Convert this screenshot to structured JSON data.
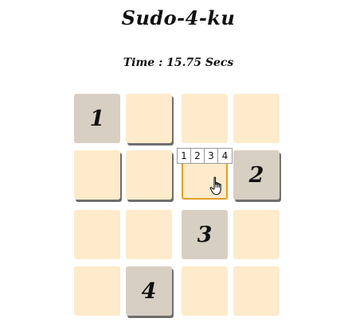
{
  "game": {
    "title": "Sudo-4-ku",
    "timer_text": "Time : 15.75 Secs"
  },
  "board": {
    "rows": [
      [
        "1",
        "",
        "",
        ""
      ],
      [
        "",
        "",
        "",
        "2"
      ],
      [
        "",
        "",
        "3",
        ""
      ],
      [
        "",
        "4",
        "",
        ""
      ]
    ]
  },
  "picker": {
    "options": [
      "1",
      "2",
      "3",
      "4"
    ]
  },
  "colors": {
    "empty_cell": "#fdebcb",
    "given_cell": "#d8cfc3",
    "active_border": "#e0a02a"
  },
  "icons": {
    "cursor": "hand-pointer-icon"
  }
}
